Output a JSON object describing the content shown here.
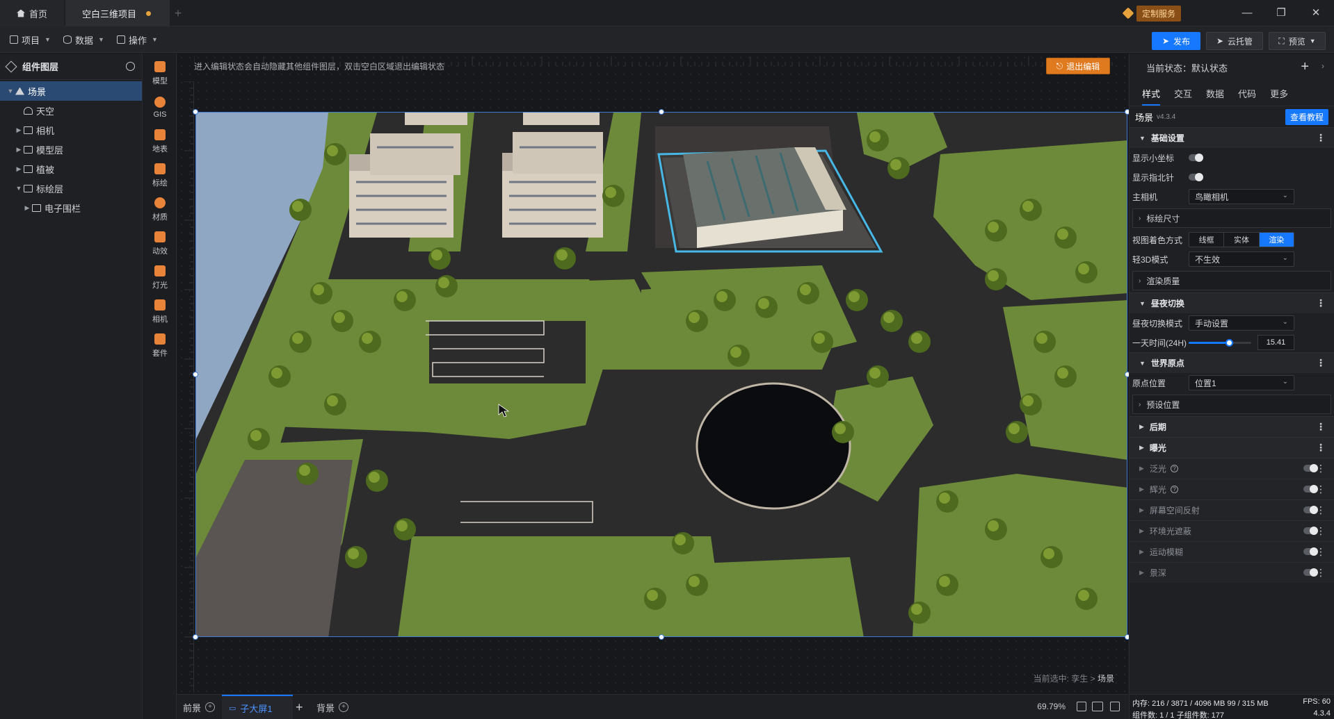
{
  "titlebar": {
    "home_tab": "首页",
    "project_tab": "空白三维项目",
    "service_label": "定制服务"
  },
  "menubar": {
    "project": "项目",
    "data": "数据",
    "operate": "操作",
    "publish": "发布",
    "cloud": "云托管",
    "preview": "预览"
  },
  "layers": {
    "title": "组件图层",
    "items": [
      {
        "label": "场景",
        "depth": 0,
        "expanded": true,
        "selected": true,
        "icon": "scene-icon"
      },
      {
        "label": "天空",
        "depth": 1,
        "expanded": false,
        "selected": false,
        "icon": "sky-icon"
      },
      {
        "label": "相机",
        "depth": 1,
        "expanded": false,
        "selected": false,
        "icon": "folder-icon"
      },
      {
        "label": "模型层",
        "depth": 1,
        "expanded": false,
        "selected": false,
        "icon": "folder-icon"
      },
      {
        "label": "植被",
        "depth": 1,
        "expanded": false,
        "selected": false,
        "icon": "folder-icon"
      },
      {
        "label": "标绘层",
        "depth": 1,
        "expanded": true,
        "selected": false,
        "icon": "folder-icon"
      },
      {
        "label": "电子围栏",
        "depth": 2,
        "expanded": false,
        "selected": false,
        "icon": "fence-icon"
      }
    ]
  },
  "tools": [
    {
      "label": "模型",
      "icon": "model-icon",
      "color": "#e8833a"
    },
    {
      "label": "GIS",
      "icon": "gis-icon",
      "color": "#e8833a"
    },
    {
      "label": "地表",
      "icon": "terrain-icon",
      "color": "#e8833a"
    },
    {
      "label": "标绘",
      "icon": "marker-icon",
      "color": "#e8833a"
    },
    {
      "label": "材质",
      "icon": "material-icon",
      "color": "#e8833a"
    },
    {
      "label": "动效",
      "icon": "effect-icon",
      "color": "#e8833a"
    },
    {
      "label": "灯光",
      "icon": "light-icon",
      "color": "#e8833a"
    },
    {
      "label": "相机",
      "icon": "camera-icon",
      "color": "#e8833a"
    },
    {
      "label": "套件",
      "icon": "kit-icon",
      "color": "#e8833a"
    }
  ],
  "canvas": {
    "hint": "进入编辑状态会自动隐藏其他组件图层，双击空白区域退出编辑状态",
    "exit_button": "退出编辑",
    "breadcrumb_prefix": "当前选中: 孪生 >",
    "breadcrumb_current": "场景"
  },
  "bottom": {
    "tab_front": "前景",
    "tab_main": "子大屏1",
    "tab_back": "背景",
    "zoom": "69.79%"
  },
  "props": {
    "state_label": "当前状态：默认状态",
    "tabs": [
      "样式",
      "交互",
      "数据",
      "代码",
      "更多"
    ],
    "active_tab": 0,
    "title": "场景",
    "version": "v4.3.4",
    "help_button": "查看教程",
    "basic_section": "基础设置",
    "show_coords": "显示小坐标",
    "show_compass": "显示指北针",
    "main_camera": "主相机",
    "main_camera_value": "鸟瞰相机",
    "marker_size": "标绘尺寸",
    "view_color_mode": "视图着色方式",
    "color_modes": [
      "线框",
      "实体",
      "渲染"
    ],
    "active_color_mode": 2,
    "light3d_mode": "轻3D模式",
    "light3d_value": "不生效",
    "render_quality": "渲染质量",
    "daynight_section": "昼夜切换",
    "daynight_mode": "昼夜切换模式",
    "daynight_mode_value": "手动设置",
    "time_of_day": "一天时间(24H)",
    "time_value": "15.41",
    "time_fraction": 0.642,
    "origin_section": "世界原点",
    "origin_position": "原点位置",
    "origin_value": "位置1",
    "preset_position": "预设位置",
    "post_section": "后期",
    "exposure_section": "曝光",
    "effects": [
      "泛光",
      "辉光",
      "屏幕空间反射",
      "环境光遮蔽",
      "运动模糊",
      "景深"
    ]
  },
  "status": {
    "memory": "内存:  216 / 3871 / 4096 MB  99 / 315 MB",
    "fps": "FPS:  60",
    "components": "组件数: 1 / 1   子组件数: 177",
    "version": "4.3.4"
  },
  "colors": {
    "accent": "#1677ff",
    "exit_orange": "#e07a1f",
    "selection_blue": "#3d7bd5"
  }
}
